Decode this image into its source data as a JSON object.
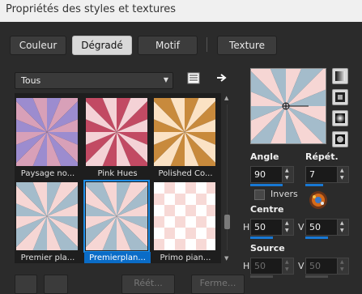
{
  "window": {
    "title": "Propriétés des styles et textures"
  },
  "tabs": [
    {
      "label": "Couleur",
      "active": false
    },
    {
      "label": "Dégradé",
      "active": true
    },
    {
      "label": "Motif",
      "active": false
    },
    {
      "label": "Texture",
      "active": false
    }
  ],
  "filter": {
    "selected": "Tous",
    "arrow": "▼"
  },
  "toolbar": {
    "book_icon": "book-icon",
    "arrow_icon": "arrow-right-icon"
  },
  "gradients": [
    {
      "name": "Paysage no...",
      "colors": [
        "#d8a0b8",
        "#9c8ccf"
      ]
    },
    {
      "name": "Pink Hues",
      "colors": [
        "#f4d2d6",
        "#c24a63"
      ]
    },
    {
      "name": "Polished Co...",
      "colors": [
        "#fbe2c4",
        "#c88a3c"
      ]
    },
    {
      "name": "Premier pla...",
      "colors": [
        "#f6d6d4",
        "#a4bccb"
      ]
    },
    {
      "name": "Premierplan...",
      "colors": [
        "#f6d6d4",
        "#a4bccb"
      ],
      "selected": true
    },
    {
      "name": "Primo pian...",
      "colors": [
        "#f7d9d6",
        "#ffffff"
      ]
    }
  ],
  "gradient_types": [
    "linear-gradient-icon",
    "rectangular-gradient-icon",
    "sunburst-gradient-icon",
    "radial-gradient-icon"
  ],
  "angle": {
    "label": "Angle",
    "value": "90"
  },
  "repeats": {
    "label": "Répét.",
    "value": "7"
  },
  "invert": {
    "label": "Invers",
    "checked": false
  },
  "center": {
    "label": "Centre",
    "h_label": "H",
    "h_value": "50",
    "v_label": "V",
    "v_value": "50"
  },
  "source": {
    "label": "Source",
    "h_label": "H",
    "h_value": "50",
    "v_label": "V",
    "v_value": "50"
  },
  "footer": {
    "btn_b": "Réét...",
    "btn_c": "Ferme..."
  },
  "colors": {
    "accent": "#1878d4",
    "panel": "#2b2b2b",
    "title_bar": "#f0f0f0"
  }
}
